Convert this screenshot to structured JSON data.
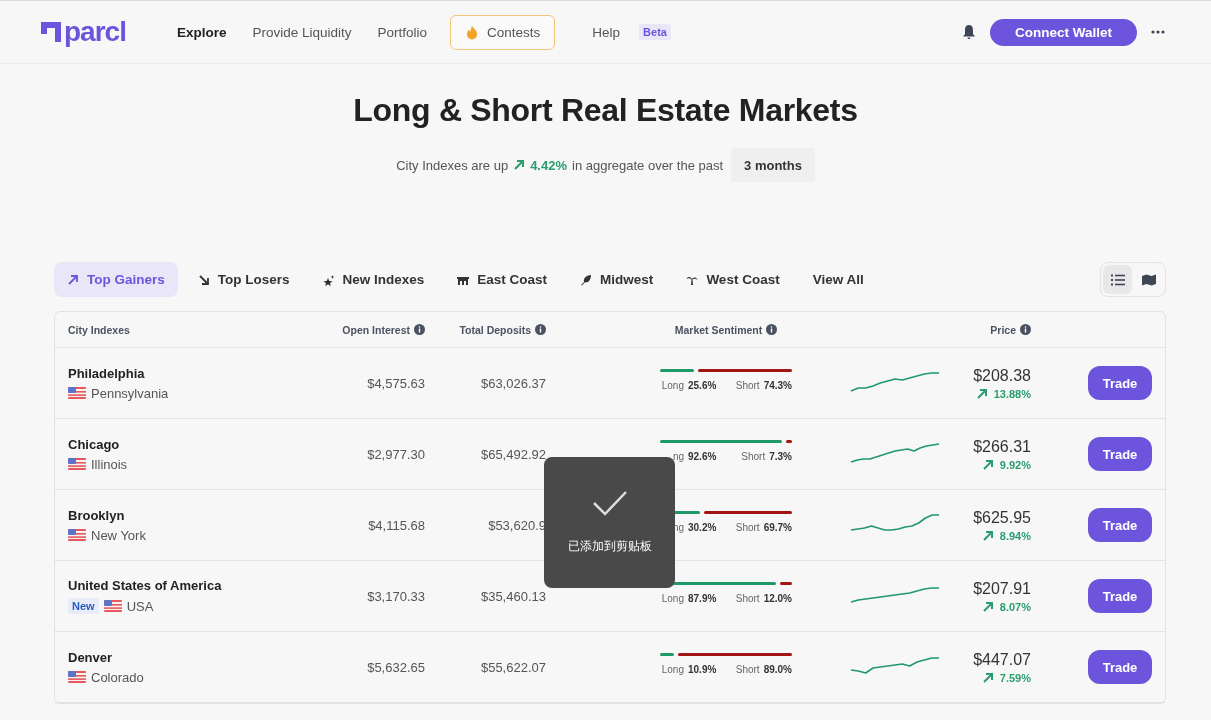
{
  "header": {
    "logo": "parcl",
    "nav": [
      {
        "label": "Explore",
        "selected": true
      },
      {
        "label": "Provide Liquidity",
        "selected": false
      },
      {
        "label": "Portfolio",
        "selected": false
      }
    ],
    "contests": "Contests",
    "help": "Help",
    "help_badge": "Beta",
    "connect": "Connect Wallet"
  },
  "hero": {
    "title": "Long & Short Real Estate Markets",
    "lead": "City Indexes are up",
    "change": "4.42%",
    "tail": "in aggregate over the past",
    "period": "3 months"
  },
  "filters": [
    {
      "label": "Top Gainers",
      "selected": true
    },
    {
      "label": "Top Losers",
      "selected": false
    },
    {
      "label": "New Indexes",
      "selected": false
    },
    {
      "label": "East Coast",
      "selected": false
    },
    {
      "label": "Midwest",
      "selected": false
    },
    {
      "label": "West Coast",
      "selected": false
    },
    {
      "label": "View All",
      "selected": false
    }
  ],
  "views": [
    {
      "kind": "list",
      "selected": true
    },
    {
      "kind": "map",
      "selected": false
    }
  ],
  "table": {
    "columns": [
      "City Indexes",
      "Open Interest",
      "Total Deposits",
      "Market Sentiment",
      "Price"
    ],
    "rows": [
      {
        "city": "Philadelphia",
        "region": "Pennsylvania",
        "open_interest": "$4,575.63",
        "deposits": "$63,026.37",
        "long_label": "Long",
        "long": "25.6%",
        "short_label": "Short",
        "short": "74.3%",
        "level": 0.256,
        "price": "$208.38",
        "change": "13.88%",
        "button": "Trade"
      },
      {
        "city": "Chicago",
        "region": "Illinois",
        "open_interest": "$2,977.30",
        "deposits": "$65,492.92",
        "long_label": "ng",
        "long": "92.6%",
        "short_label": "Short",
        "short": "7.3%",
        "level": 0.926,
        "price": "$266.31",
        "change": "9.92%",
        "button": "Trade"
      },
      {
        "city": "Brooklyn",
        "region": "New York",
        "open_interest": "$4,115.68",
        "deposits": "$53,620.9",
        "long_label": "ng",
        "long": "30.2%",
        "short_label": "Short",
        "short": "69.7%",
        "level": 0.302,
        "price": "$625.95",
        "change": "8.94%",
        "button": "Trade"
      },
      {
        "city": "United States of America",
        "badge": "New",
        "region": "USA",
        "open_interest": "$3,170.33",
        "deposits": "$35,460.13",
        "long_label": "Long",
        "long": "87.9%",
        "short_label": "Short",
        "short": "12.0%",
        "level": 0.879,
        "price": "$207.91",
        "change": "8.07%",
        "button": "Trade"
      },
      {
        "city": "Denver",
        "region": "Colorado",
        "open_interest": "$5,632.65",
        "deposits": "$55,622.07",
        "long_label": "Long",
        "long": "10.9%",
        "short_label": "Short",
        "short": "89.0%",
        "level": 0.109,
        "price": "$447.07",
        "change": "7.59%",
        "button": "Trade"
      }
    ]
  },
  "toast": {
    "message": "已添加到剪贴板"
  }
}
